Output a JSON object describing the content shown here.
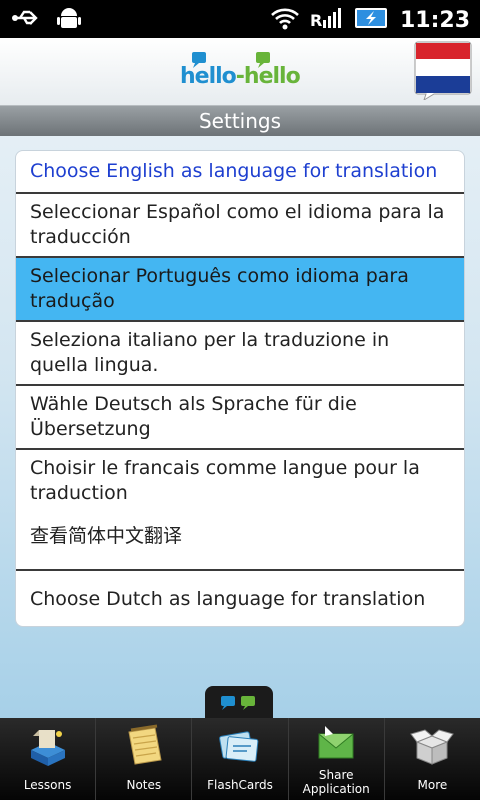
{
  "status_bar": {
    "time": "11:23",
    "icons": [
      "usb-icon",
      "android-icon",
      "wifi-icon",
      "signal-icon",
      "battery-icon"
    ]
  },
  "header": {
    "logo": {
      "part1": "hello",
      "dash": "-",
      "part2": "hello"
    },
    "flag_icon": "dutch-flag-speech-bubble-icon",
    "colors": {
      "logo_blue": "#1f8fd0",
      "logo_green": "#68b43a"
    }
  },
  "title_bar": {
    "title": "Settings"
  },
  "languages": [
    {
      "label": "Choose English as language for translation"
    },
    {
      "label": "Seleccionar Español como el idioma para la traducción"
    },
    {
      "label": "Selecionar Português como idioma para tradução"
    },
    {
      "label": "Seleziona italiano per la traduzione in quella lingua."
    },
    {
      "label": "Wähle Deutsch als Sprache für die Übersetzung"
    },
    {
      "label": "Choisir le francais comme langue pour la traduction"
    },
    {
      "label": "查看简体中文翻译"
    },
    {
      "label": "Choose Dutch as language for translation"
    }
  ],
  "selected_index": 2,
  "colors": {
    "selected": "#44b6f2",
    "first_item_text": "#1e3fd0"
  },
  "bottom_nav": [
    {
      "label": "Lessons",
      "icon": "book-lessons-icon"
    },
    {
      "label": "Notes",
      "icon": "notepad-icon"
    },
    {
      "label": "FlashCards",
      "icon": "flashcards-icon"
    },
    {
      "label": "Share\nApplication",
      "icon": "envelope-share-icon"
    },
    {
      "label": "More",
      "icon": "box-more-icon"
    }
  ]
}
